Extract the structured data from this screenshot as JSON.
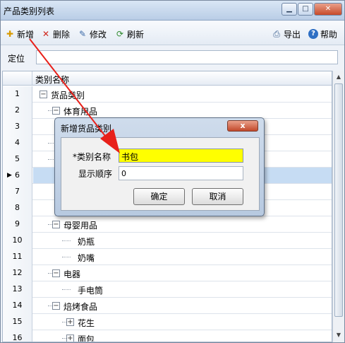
{
  "window": {
    "title": "产品类别列表",
    "min_label": "▁",
    "max_label": "□",
    "close_label": "✕"
  },
  "toolbar": {
    "add_label": "新增",
    "delete_label": "删除",
    "edit_label": "修改",
    "refresh_label": "刷新",
    "export_label": "导出",
    "help_label": "帮助"
  },
  "locate": {
    "label": "定位",
    "value": ""
  },
  "grid": {
    "column_header": "类别名称",
    "rows": [
      {
        "n": "1",
        "label": "货品类别",
        "level": 0,
        "expander": "−"
      },
      {
        "n": "2",
        "label": "体育用品",
        "level": 1,
        "expander": "−"
      },
      {
        "n": "3",
        "label": "",
        "level": 2,
        "expander": ""
      },
      {
        "n": "4",
        "label": "",
        "level": 1,
        "expander": ""
      },
      {
        "n": "5",
        "label": "",
        "level": 1,
        "expander": ""
      },
      {
        "n": "6",
        "label": "",
        "level": 2,
        "expander": ""
      },
      {
        "n": "7",
        "label": "",
        "level": 2,
        "expander": ""
      },
      {
        "n": "8",
        "label": "",
        "level": 2,
        "expander": ""
      },
      {
        "n": "9",
        "label": "母婴用品",
        "level": 1,
        "expander": "−"
      },
      {
        "n": "10",
        "label": "奶瓶",
        "level": 2,
        "expander": ""
      },
      {
        "n": "11",
        "label": "奶嘴",
        "level": 2,
        "expander": ""
      },
      {
        "n": "12",
        "label": "电器",
        "level": 1,
        "expander": "−"
      },
      {
        "n": "13",
        "label": "手电筒",
        "level": 2,
        "expander": ""
      },
      {
        "n": "14",
        "label": "焙烤食品",
        "level": 1,
        "expander": "−"
      },
      {
        "n": "15",
        "label": "花生",
        "level": 2,
        "expander": "+"
      },
      {
        "n": "16",
        "label": "面包",
        "level": 2,
        "expander": "+"
      }
    ],
    "selected_row": 6
  },
  "dialog": {
    "title": "新增货品类别",
    "close_label": "x",
    "name_label": "*类别名称",
    "name_value": "书包",
    "order_label": "显示顺序",
    "order_value": "0",
    "ok_label": "确定",
    "cancel_label": "取消"
  },
  "colors": {
    "highlight_field": "#ffff00",
    "arrow": "#e8201a",
    "selection": "#c6dcf3"
  }
}
